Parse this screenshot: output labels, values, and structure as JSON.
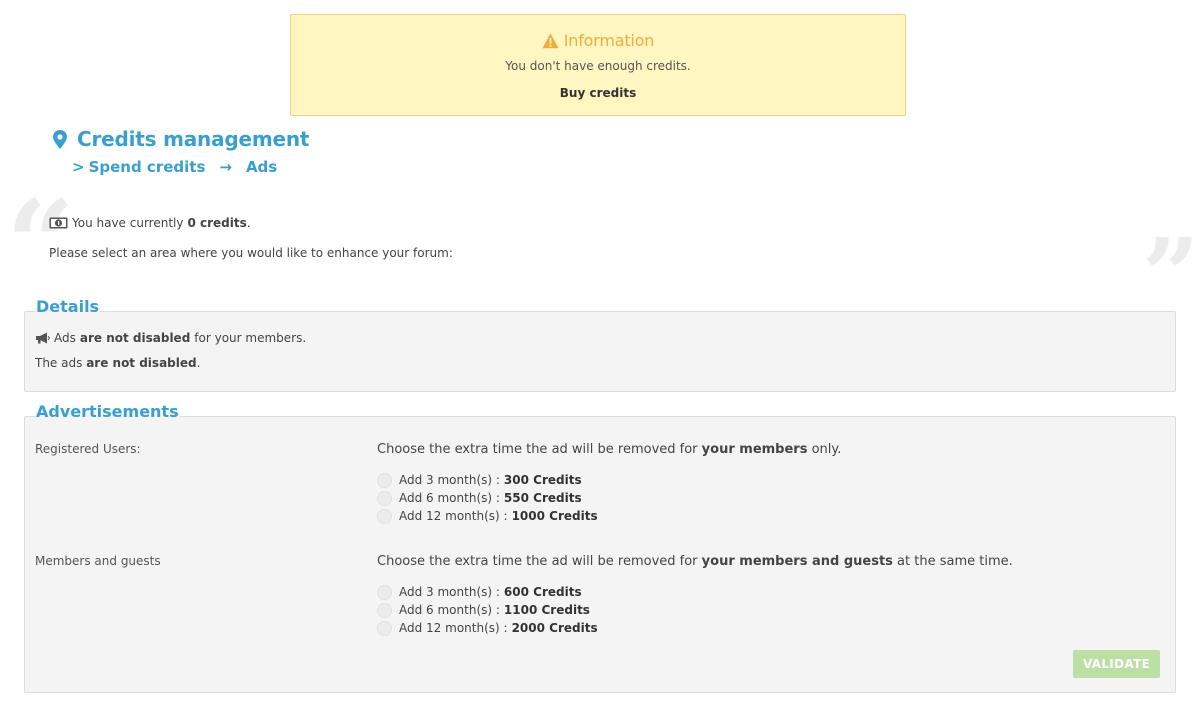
{
  "info": {
    "icon": "warning-icon",
    "title": "Information",
    "message": "You don't have enough credits.",
    "buy_label": "Buy credits",
    "colors": {
      "background": "#fff6c1",
      "border": "#f2d27e",
      "title": "#f0ad3a"
    }
  },
  "header": {
    "icon": "map-marker-icon",
    "title": "Credits management",
    "breadcrumb": {
      "prefix": ">",
      "items": [
        "Spend credits",
        "Ads"
      ],
      "separator": "→"
    },
    "accent_color": "#3a9fcf"
  },
  "intro": {
    "credits_icon": "money-icon",
    "credits_prefix": "You have currently",
    "credits_value": "0 credits",
    "credits_suffix": ".",
    "select_text": "Please select an area where you would like to enhance your forum:"
  },
  "details": {
    "legend": "Details",
    "line1": {
      "icon": "megaphone-icon",
      "prefix": "Ads",
      "bold": "are not disabled",
      "suffix": "for your members."
    },
    "line2": {
      "prefix": "The ads",
      "bold": "are not disabled",
      "suffix": "."
    }
  },
  "advertisements": {
    "legend": "Advertisements",
    "groups": [
      {
        "label": "Registered Users:",
        "desc_prefix": "Choose the extra time the ad will be removed for",
        "desc_bold": "your members",
        "desc_suffix": "only.",
        "options": [
          {
            "label": "Add 3 month(s) :",
            "price": "300 Credits",
            "selected": false
          },
          {
            "label": "Add 6 month(s) :",
            "price": "550 Credits",
            "selected": false
          },
          {
            "label": "Add 12 month(s) :",
            "price": "1000 Credits",
            "selected": false
          }
        ]
      },
      {
        "label": "Members and guests",
        "desc_prefix": "Choose the extra time the ad will be removed for",
        "desc_bold": "your members and guests",
        "desc_suffix": "at the same time.",
        "options": [
          {
            "label": "Add 3 month(s) :",
            "price": "600 Credits",
            "selected": false
          },
          {
            "label": "Add 6 month(s) :",
            "price": "1100 Credits",
            "selected": false
          },
          {
            "label": "Add 12 month(s) :",
            "price": "2000 Credits",
            "selected": false
          }
        ]
      }
    ],
    "validate_label": "VALIDATE",
    "validate_color": "#bcdfa6"
  }
}
